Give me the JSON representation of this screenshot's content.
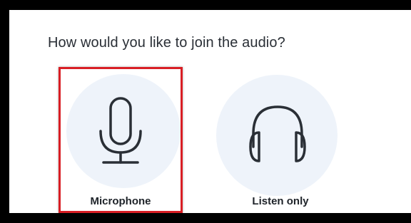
{
  "dialog": {
    "question": "How would you like to join the audio?"
  },
  "options": [
    {
      "label": "Microphone",
      "icon": "microphone-icon",
      "selected": true
    },
    {
      "label": "Listen only",
      "icon": "headphones-icon",
      "selected": false
    }
  ],
  "colors": {
    "circle_bg": "#eef3fa",
    "icon_stroke": "#2a2f36",
    "selection_border": "#d91e24"
  }
}
